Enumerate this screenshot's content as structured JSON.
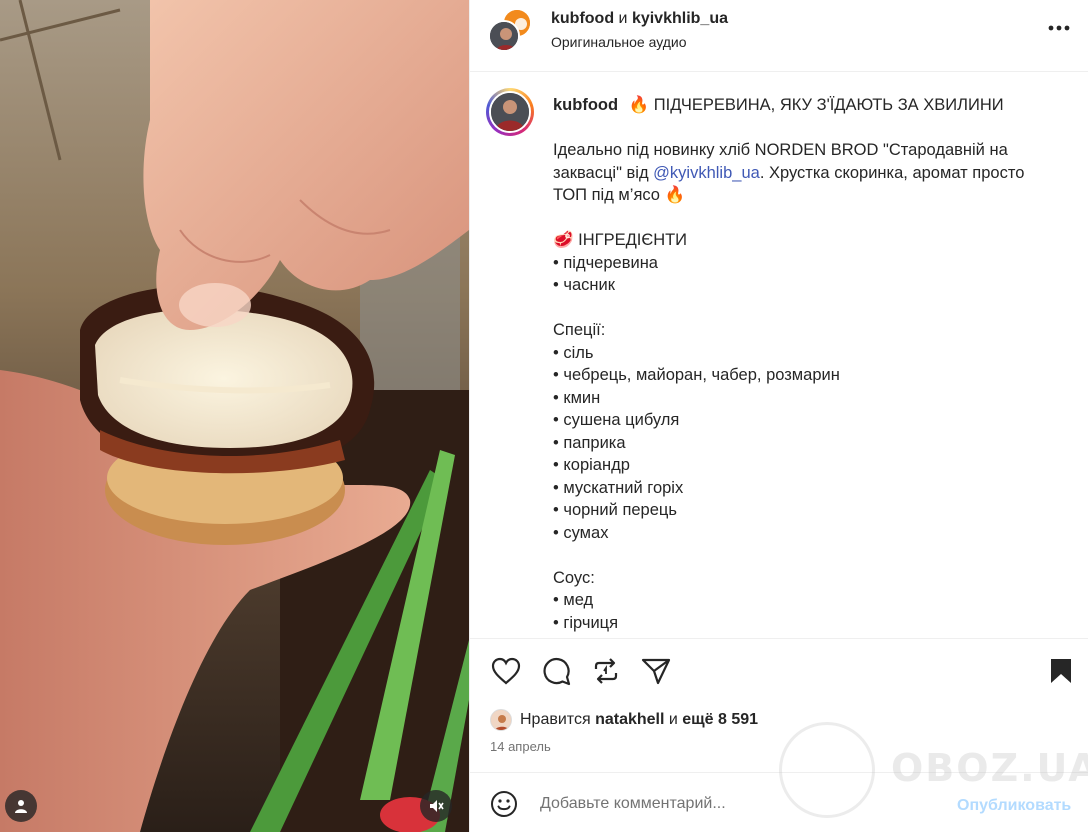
{
  "header": {
    "user1": "kubfood",
    "conjunction": "и",
    "user2": "kyivkhlib_ua",
    "audio": "Оригинальное аудио"
  },
  "caption": {
    "username": "kubfood",
    "title": "🔥 ПІДЧЕРЕВИНА, ЯКУ З'ЇДАЮТЬ ЗА ХВИЛИНИ",
    "intro_part1": "Ідеально під новинку хліб NORDEN BROD \"Стародавній на заквасці\" від ",
    "intro_mention": "@kyivkhlib_ua",
    "intro_part2": ". Хрустка скоринка, аромат просто ТОП під м’ясо 🔥",
    "ingredients_title": "🥩 ІНГРЕДІЄНТИ",
    "ingredients": [
      "• підчеревина",
      "• часник"
    ],
    "spices_title": "Спеції:",
    "spices": [
      "• сіль",
      "• чебрець, майоран, чабер, розмарин",
      "• кмин",
      "• сушена цибуля",
      "• паприка",
      "• коріандр",
      "• мускатний горіх",
      "• чорний перець",
      "• сумах"
    ],
    "sauce_title": "Соус:",
    "sauce": [
      "• мед",
      "• гірчиця"
    ]
  },
  "likes": {
    "prefix": "Нравится",
    "liker": "natakhell",
    "middle": "и",
    "others": "ещё 8 591"
  },
  "date": "14 апрель",
  "comment": {
    "placeholder": "Добавьте комментарий...",
    "publish": "Опубликовать"
  },
  "watermark": "OBOZ.UA",
  "icons": {
    "like": "heart-icon",
    "comment": "comment-icon",
    "repost": "repost-icon",
    "share": "share-icon",
    "save": "bookmark-icon",
    "more": "more-icon",
    "emoji": "emoji-icon",
    "mute": "mute-icon",
    "tag": "user-tag-icon"
  },
  "colors": {
    "text": "#262626",
    "muted": "#737373",
    "mention": "#4059b5",
    "publish_disabled": "#b3dbff",
    "border": "#efefef"
  }
}
